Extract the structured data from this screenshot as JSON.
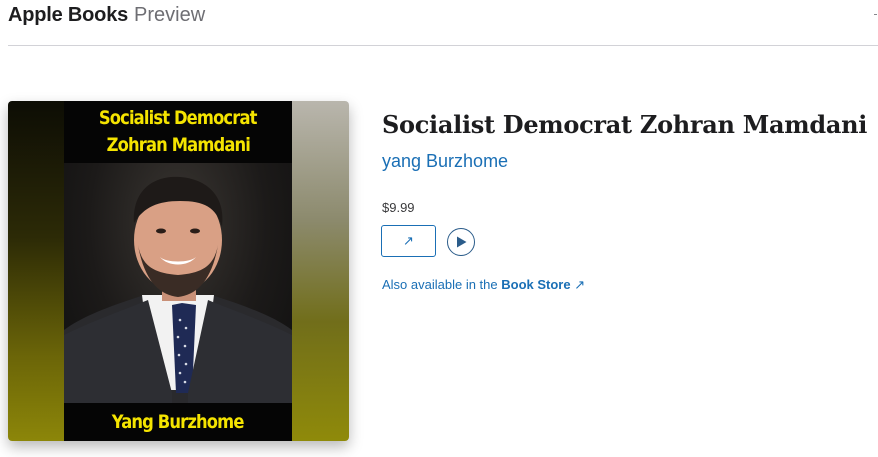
{
  "header": {
    "brand": "Apple Books",
    "subtitle": "Preview"
  },
  "cover": {
    "title_line1": "Socialist Democrat",
    "title_line2": "Zohran Mamdani",
    "author": "Yang Burzhome",
    "accent_color": "#f5e400"
  },
  "book": {
    "title": "Socialist Democrat Zohran Mamdani",
    "author": "yang Burzhome",
    "price": "$9.99"
  },
  "actions": {
    "open_icon": "arrow-up-right-icon",
    "open_glyph": "↗",
    "play_icon": "play-icon"
  },
  "also_available": {
    "prefix": "Also available in the ",
    "store": "Book Store",
    "arrow": "↗"
  },
  "colors": {
    "link": "#1a6fb5",
    "text": "#1d1d1f",
    "divider": "#d2d2d7"
  }
}
